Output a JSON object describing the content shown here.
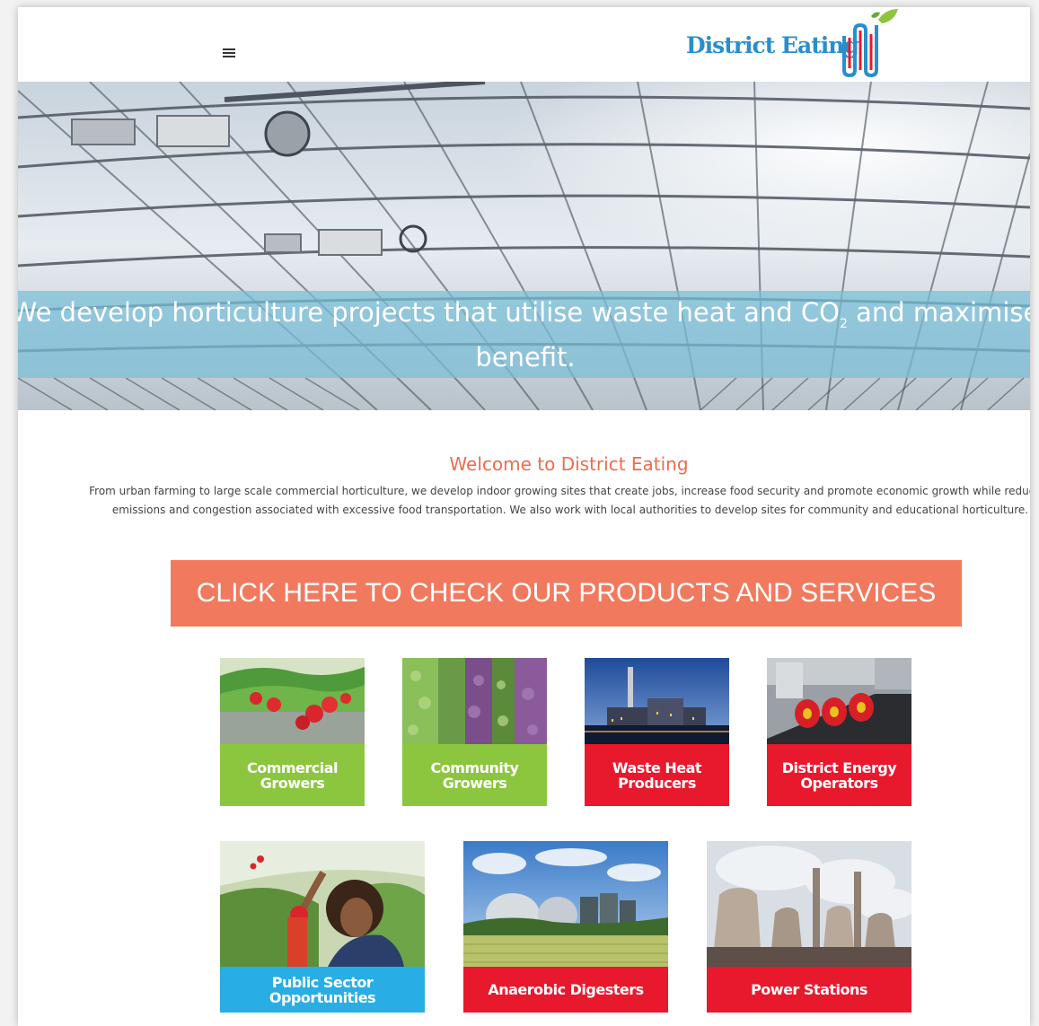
{
  "header": {
    "menu_icon": "hamburger-menu-icon",
    "logo_text": "District Eating"
  },
  "hero": {
    "headline_before": "We develop horticulture projects that utilise waste heat and CO",
    "headline_sub": "2",
    "headline_after": " and maximise benefit."
  },
  "welcome": {
    "title": "Welcome to District Eating",
    "body": "From urban farming to large scale commercial horticulture, we develop indoor growing sites that create jobs, increase food security and promote economic growth while reducing emissions and congestion associated with excessive food transportation. We also work with local authorities to develop sites for community and educational horticulture."
  },
  "cta": {
    "label": "CLICK HERE TO CHECK OUR PRODUCTS AND SERVICES"
  },
  "tiles_row1": [
    {
      "label": "Commercial Growers",
      "color": "#8cc63f"
    },
    {
      "label": "Community Growers",
      "color": "#8cc63f"
    },
    {
      "label": "Waste Heat Producers",
      "color": "#e8192c"
    },
    {
      "label": "District Energy Operators",
      "color": "#e8192c"
    }
  ],
  "tiles_row2": [
    {
      "label": "Public Sector Opportunities",
      "color": "#28aee4"
    },
    {
      "label": "Anaerobic Digesters",
      "color": "#e8192c"
    },
    {
      "label": "Power Stations",
      "color": "#e8192c"
    }
  ],
  "colors": {
    "accent": "#ee6b4d",
    "cta": "#f17a5e",
    "logo_blue": "#2a8ecc"
  }
}
